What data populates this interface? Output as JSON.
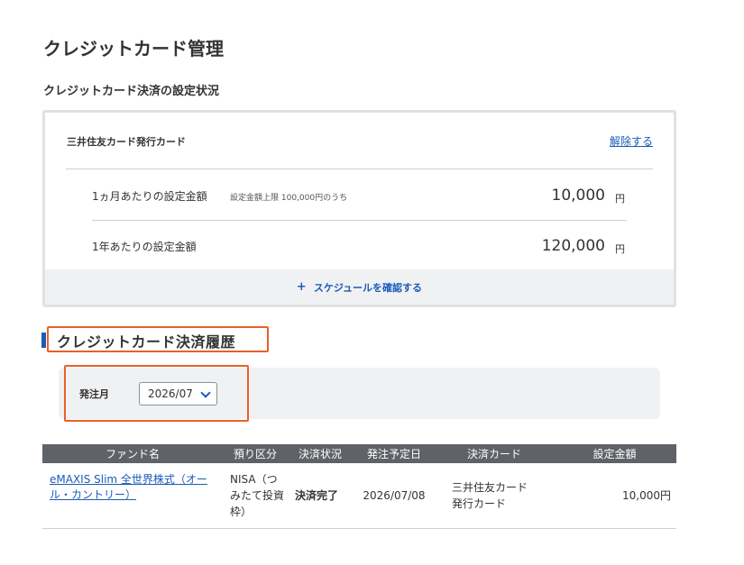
{
  "page": {
    "title": "クレジットカード管理",
    "settings_subtitle": "クレジットカード決済の設定状況"
  },
  "card": {
    "name": "三井住友カード発行カード",
    "cancel_label": "解除する",
    "monthly": {
      "label": "1ヵ月あたりの設定金額",
      "note": "設定金額上限 100,000円のうち",
      "amount": "10,000",
      "unit": "円"
    },
    "yearly": {
      "label": "1年あたりの設定金額",
      "amount": "120,000",
      "unit": "円"
    },
    "schedule_link": "スケジュールを確認する",
    "schedule_icon": "+"
  },
  "history": {
    "title": "クレジットカード決済履歴",
    "filter_label": "発注月",
    "month_selected": "2026/07",
    "columns": [
      "ファンド名",
      "預り区分",
      "決済状況",
      "発注予定日",
      "決済カード",
      "設定金額"
    ],
    "rows": [
      {
        "fund": "eMAXIS Slim 全世界株式（オール・カントリー）",
        "account": "NISA（つみたて投資枠）",
        "status": "決済完了",
        "order_date": "2026/07/08",
        "card": "三井住友カード発行カード",
        "amount": "10,000円"
      }
    ]
  },
  "colors": {
    "accent": "#1a5bb8",
    "highlight": "#e8602c",
    "table_header": "#5f6368"
  }
}
